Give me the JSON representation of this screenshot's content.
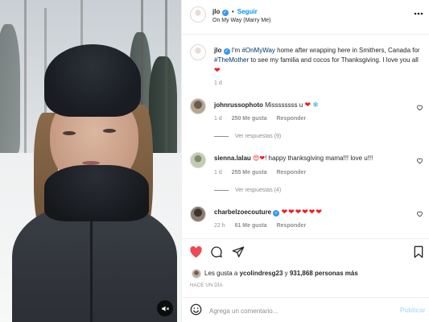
{
  "post": {
    "author": "jlo",
    "follow_label": "Seguir",
    "separator": "•",
    "song": "On My Way (Marry Me)",
    "more_icon": "more-dots-icon",
    "caption_user": "jlo",
    "caption_1": " I'm ",
    "caption_tag1": "#OnMyWay",
    "caption_2": " home after wrapping here in Smithers, Canada for ",
    "caption_tag2": "#TheMother",
    "caption_3": " to see my familia and cocos for Thanksgiving. I love you all ",
    "caption_emoji": "❤",
    "caption_time": "1 d"
  },
  "comments": [
    {
      "user": "johnrussophoto",
      "text": " Missssssss u ",
      "emoji": "❤",
      "emoji2": "❄",
      "time": "1 d",
      "likes": "250 Me gusta",
      "reply": "Responder",
      "view_replies": "Ver respuestas (9)"
    },
    {
      "user": "sienna.lalau",
      "emoji_lead": "😍❤",
      "text": "! happy thanksgiving mama!!! love u!!!",
      "time": "1 d",
      "likes": "255 Me gusta",
      "reply": "Responder",
      "view_replies": "Ver respuestas (4)"
    },
    {
      "user": "charbelzoecouture",
      "hearts": "❤❤❤❤❤❤",
      "time": "22 h",
      "likes": "61 Me gusta",
      "reply": "Responder"
    }
  ],
  "likes_line": {
    "prefix": "Les gusta a ",
    "user": "ycolindresg23",
    "middle": " y ",
    "count": "931,868 personas más"
  },
  "timestamp": "HACE UN DÍA",
  "add_comment": {
    "placeholder": "Agrega un comentario...",
    "submit": "Publicar"
  },
  "colors": {
    "accent": "#0095f6",
    "like_red": "#ed4956",
    "verified": "#3897f0"
  }
}
